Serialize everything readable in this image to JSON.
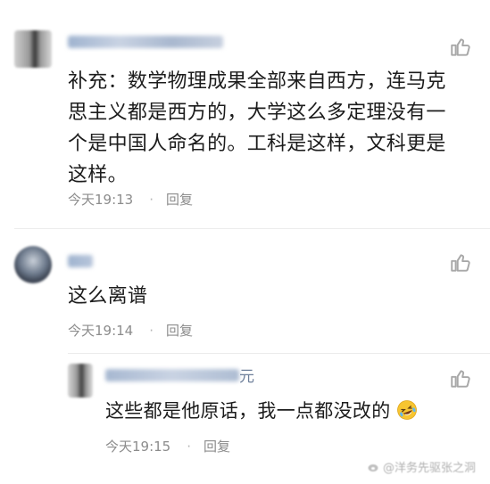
{
  "comments": [
    {
      "body": "补充：数学物理成果全部来自西方，连马克思主义都是西方的，大学这么多定理没有一个是中国人命名的。工科是这样，文科更是这样。",
      "time": "今天19:13",
      "dot": "·",
      "reply": "回复"
    },
    {
      "body": "这么离谱",
      "time": "今天19:14",
      "dot": "·",
      "reply": "回复"
    },
    {
      "name_tail": "元",
      "body": "这些都是他原话，我一点都没改的",
      "time": "今天19:15",
      "dot": "·",
      "reply": "回复"
    }
  ],
  "watermark": "@洋务先驱张之洞",
  "icons": {
    "like": "thumbs-up-icon",
    "emoji": "rofl-emoji-icon",
    "weibo": "weibo-logo-icon"
  },
  "colors": {
    "meta_text": "#8c8c8c",
    "body_text": "#1c1c1c",
    "icon_stroke": "#a8a8a8"
  }
}
